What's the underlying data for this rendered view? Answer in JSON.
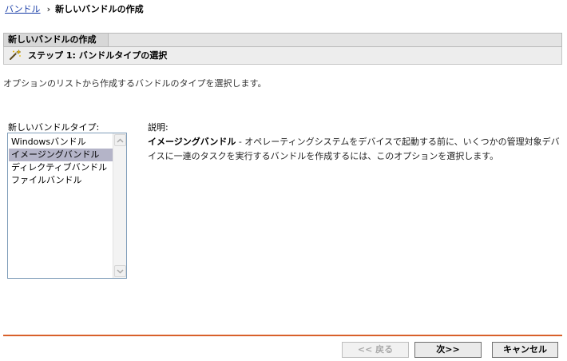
{
  "breadcrumb": {
    "parent": "バンドル",
    "separator": "›",
    "current": "新しいバンドルの作成"
  },
  "wizard": {
    "title": "新しいバンドルの作成",
    "step_label": "ステップ 1: バンドルタイプの選択",
    "step_icon": "wand-icon",
    "instructions": "オプションのリストから作成するバンドルのタイプを選択します。"
  },
  "bundle_types": {
    "label": "新しいバンドルタイプ:",
    "items": [
      {
        "label": "Windowsバンドル",
        "selected": false
      },
      {
        "label": "イメージングバンドル",
        "selected": true
      },
      {
        "label": "ディレクティブバンドル",
        "selected": false
      },
      {
        "label": "ファイルバンドル",
        "selected": false
      }
    ]
  },
  "description": {
    "label": "説明:",
    "term": "イメージングバンドル",
    "text": " - オペレーティングシステムをデバイスで起動する前に、いくつかの管理対象デバイスに一連のタスクを実行するバンドルを作成するには、このオプションを選択します。"
  },
  "buttons": {
    "back": "<< 戻る",
    "next": "次>>",
    "cancel": "キャンセル"
  },
  "colors": {
    "divider": "#d8602a",
    "link": "#1a3ea8",
    "selection": "#b4b4c8"
  }
}
